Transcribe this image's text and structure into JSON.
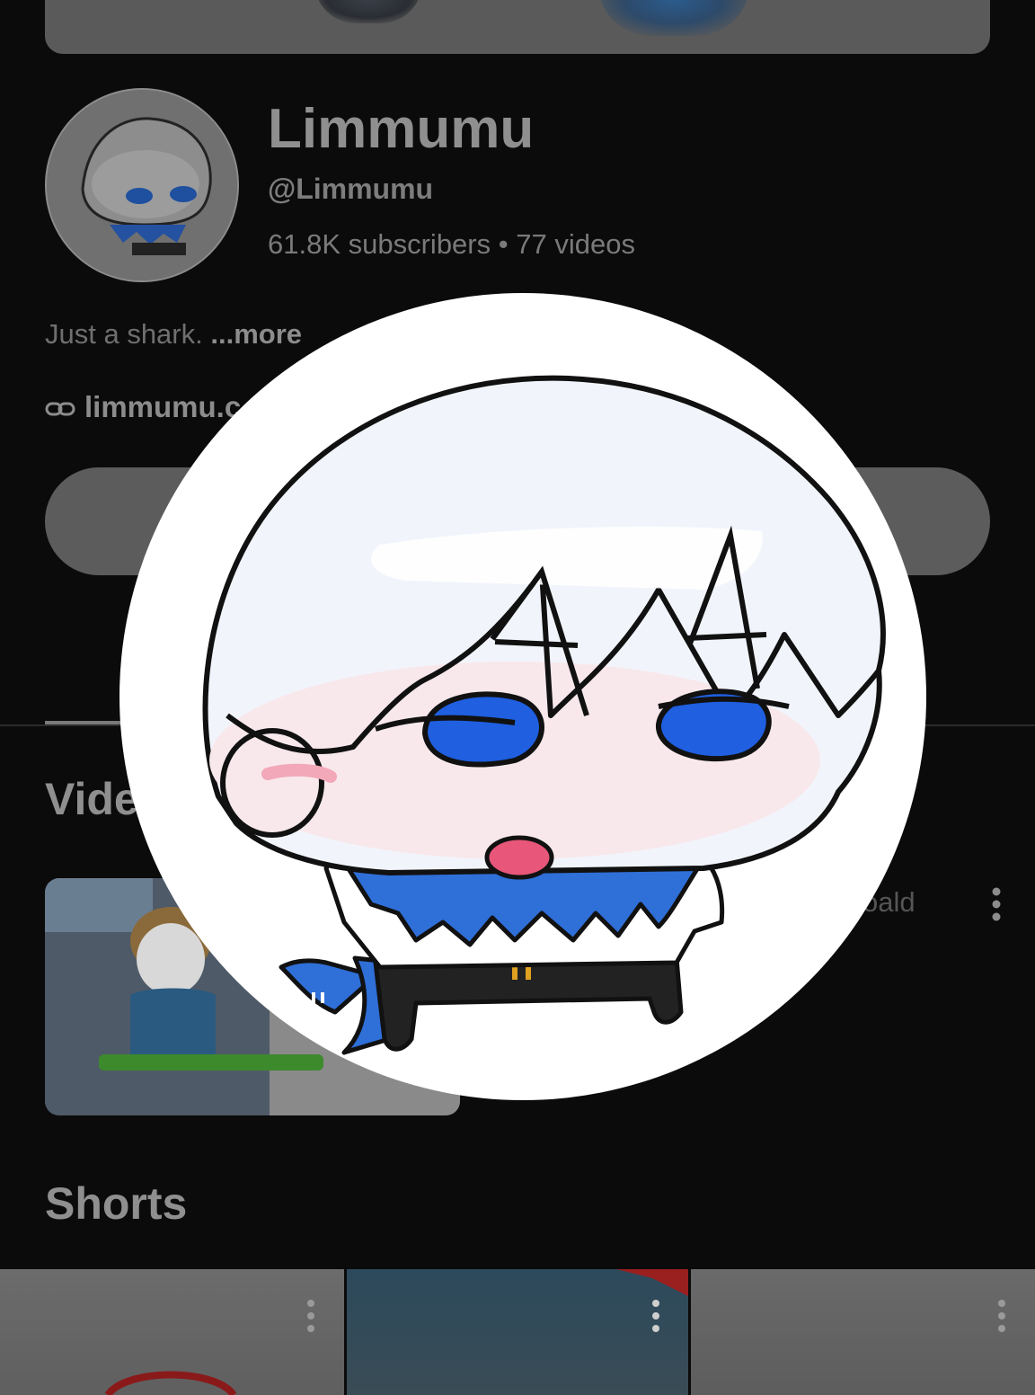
{
  "channel": {
    "name": "Limmumu",
    "handle": "@Limmumu",
    "subscribers": "61.8K subscribers",
    "separator": "•",
    "video_count": "77 videos",
    "description": "Just a shark.",
    "more_label": "...more",
    "link": "limmumu.c"
  },
  "tabs": {
    "videos_heading": "Vide"
  },
  "videos": {
    "first_title_fragment": "oald"
  },
  "shorts": {
    "heading": "Shorts"
  },
  "colors": {
    "accent_blue": "#1f5fe0",
    "background": "#0b0b0b"
  },
  "icons": [
    "link-icon",
    "more-vert-icon"
  ]
}
